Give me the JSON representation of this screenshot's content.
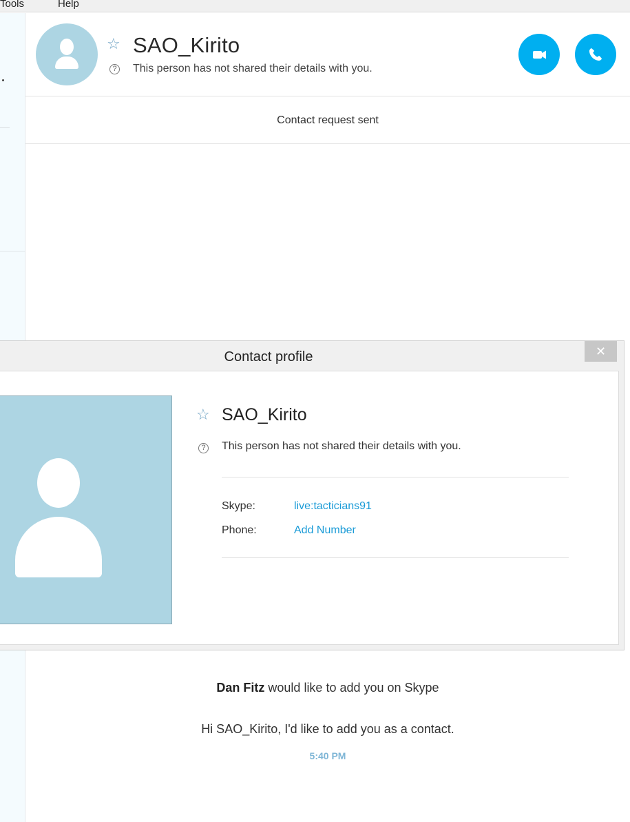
{
  "menu": {
    "tools": "Tools",
    "help": "Help"
  },
  "header": {
    "name": "SAO_Kirito",
    "subtitle": "This person has not shared their details with you.",
    "star_icon": "star-outline-icon",
    "info_icon": "question-circle-icon"
  },
  "status": {
    "text": "Contact request sent"
  },
  "dialog": {
    "title": "Contact profile",
    "close_glyph": "✕",
    "name": "SAO_Kirito",
    "subtitle": "This person has not shared their details with you.",
    "fields": [
      {
        "label": "Skype:",
        "value": "live:tacticians91"
      },
      {
        "label": "Phone:",
        "value": "Add Number"
      }
    ]
  },
  "messages": {
    "request_sender": "Dan Fitz",
    "request_text": " would like to add you on Skype",
    "body": "Hi SAO_Kirito, I'd like to add you as a contact.",
    "time": "5:40 PM"
  },
  "colors": {
    "accent": "#00aff0",
    "link": "#1a9bd7",
    "avatar_bg": "#add5e3",
    "timestamp": "#7fb6d6"
  }
}
